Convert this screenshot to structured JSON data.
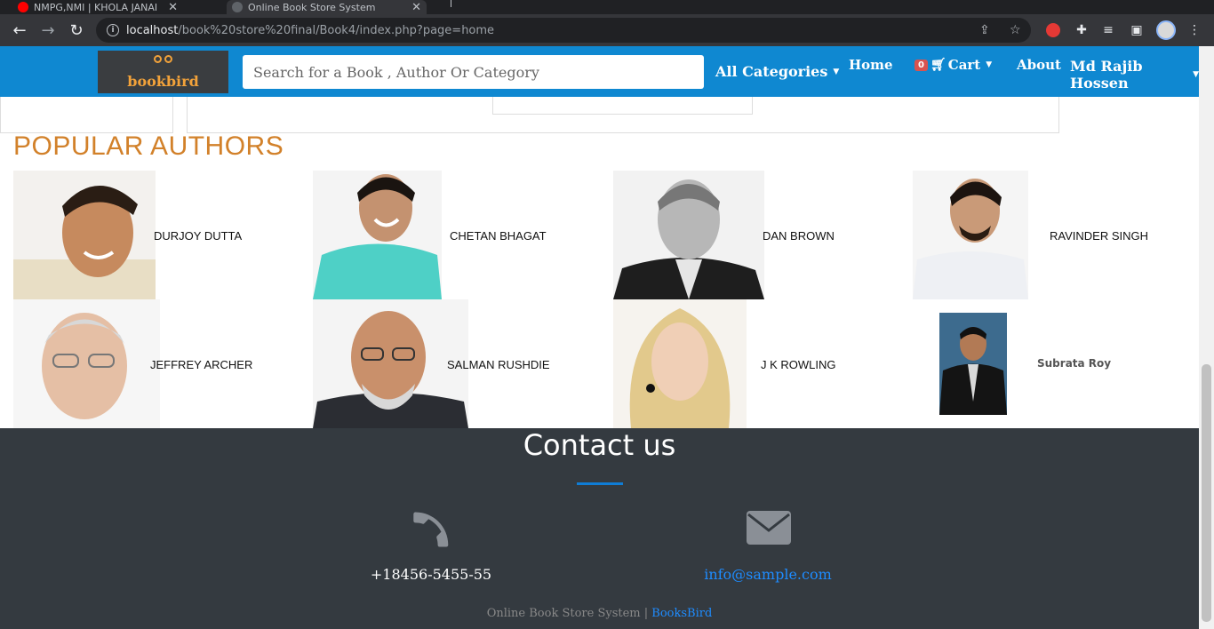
{
  "browser": {
    "tabs": [
      {
        "title": "ΝΜΡG,ΝΜΙ | KHOLA JANAI"
      },
      {
        "title": "Online Book Store System"
      }
    ],
    "url_host": "localhost",
    "url_path": "/book%20store%20final/Book4/index.php?page=home"
  },
  "navbar": {
    "logo_text": "bookbird",
    "search_placeholder": "Search for a Book , Author Or Category",
    "categories_label": "All Categories",
    "home_label": "Home",
    "cart_count": "0",
    "cart_label": "Cart",
    "about_label": "About",
    "user_name": "Md Rajib Hossen"
  },
  "section": {
    "title": "POPULAR AUTHORS"
  },
  "authors": [
    {
      "name": "DURJOY DUTTA"
    },
    {
      "name": "CHETAN BHAGAT"
    },
    {
      "name": "DAN BROWN"
    },
    {
      "name": "RAVINDER SINGH"
    },
    {
      "name": "JEFFREY ARCHER"
    },
    {
      "name": "SALMAN RUSHDIE"
    },
    {
      "name": "J K ROWLING"
    },
    {
      "name": "Subrata Roy"
    }
  ],
  "footer": {
    "title": "Contact us",
    "phone": "+18456-5455-55",
    "email": "info@sample.com",
    "bottom_text": "Online Book Store System |",
    "bottom_link": "BooksBird"
  },
  "icons": {
    "phone": "phone-icon",
    "email": "envelope-icon"
  },
  "colors": {
    "navbar": "#0f88d1",
    "section_title": "#d2812a",
    "footer_bg": "#343a40",
    "link_blue": "#1e8cff"
  }
}
